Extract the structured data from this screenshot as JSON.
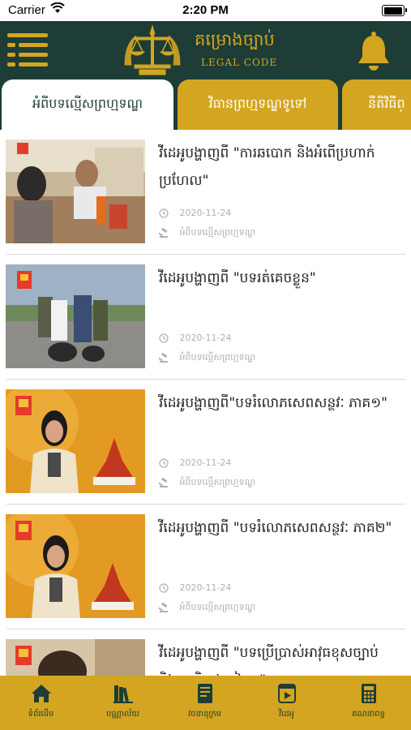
{
  "status_bar": {
    "carrier": "Carrier",
    "time": "2:20 PM"
  },
  "header": {
    "title": "គម្រោងច្បាប់",
    "subtitle": "LEGAL CODE"
  },
  "tabs": [
    {
      "label": "អំពីបទល្មើសព្រហ្មទណ្ឌ",
      "active": true
    },
    {
      "label": "វិធានព្រហ្មទណ្ឌទូទៅ",
      "active": false
    },
    {
      "label": "នីតិវិធីព្",
      "active": false
    }
  ],
  "videos": [
    {
      "title": "វីដេអូបង្ហាញពី \"ការឆបោក និងអំពើប្រហាក់ប្រហែល\"",
      "date": "2020-11-24",
      "category": "អំពីបទល្មើសព្រហ្មទណ្ឌ"
    },
    {
      "title": "វីដេអូបង្ហាញពី \"បទរត់គេចខ្លួន\"",
      "date": "2020-11-24",
      "category": "អំពីបទល្មើសព្រហ្មទណ្ឌ"
    },
    {
      "title": "វីដេអូបង្ហាញពី\"បទរំលោភសេពសន្ថវៈ ភាគ១\"",
      "date": "2020-11-24",
      "category": "អំពីបទល្មើសព្រហ្មទណ្ឌ"
    },
    {
      "title": "វីដេអូបង្ហាញពី \"បទរំលោភសេពសន្ថវៈ ភាគ២\"",
      "date": "2020-11-24",
      "category": "អំពីបទល្មើសព្រហ្មទណ្ឌ"
    },
    {
      "title": "វីដេអូបង្ហាញពី \"បទប្រើប្រាស់អាវុធខុសច្បាប់ និងបទពិរុទ្ធឯទៀតៗ\"",
      "date": "",
      "category": ""
    }
  ],
  "bottom_nav": [
    {
      "label": "ទំព័រដើម",
      "icon": "home-icon"
    },
    {
      "label": "បណ្ណាល័យ",
      "icon": "library-icon"
    },
    {
      "label": "វចនានុក្រម",
      "icon": "dictionary-icon"
    },
    {
      "label": "វីដេអូ",
      "icon": "video-icon"
    },
    {
      "label": "គណនាពន្ធ",
      "icon": "calculator-icon"
    }
  ],
  "colors": {
    "header_bg": "#1d3d36",
    "accent_gold": "#d4a520",
    "divider": "#d9d9d9",
    "meta_text": "#b0b0b0"
  }
}
